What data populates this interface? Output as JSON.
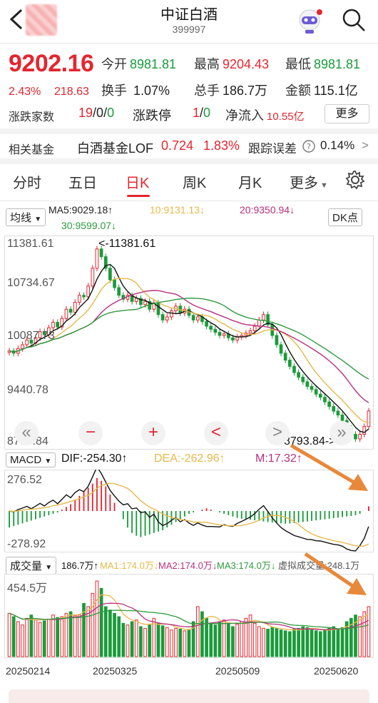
{
  "header": {
    "title": "中证白酒",
    "code": "399997"
  },
  "quote": {
    "price": "9202.16",
    "change_pct": "2.43%",
    "change_abs": "218.63",
    "open_label": "今开",
    "open": "8981.81",
    "high_label": "最高",
    "high": "9204.43",
    "low_label": "最低",
    "low": "8981.81",
    "turnover_label": "换手",
    "turnover": "1.07%",
    "volume_label": "总手",
    "volume": "186.7万",
    "amount_label": "金额",
    "amount": "115.1亿",
    "breadth_label": "涨跌家数",
    "breadth_up": "19",
    "breadth_sep1": "/",
    "breadth_flat": "0",
    "breadth_sep2": "/",
    "breadth_down": "0",
    "limit_label": "涨跌停",
    "limit_up": "1",
    "limit_sep": "/",
    "limit_down": "0",
    "netflow_label": "净流入",
    "netflow": "10.55亿",
    "more_button": "更多"
  },
  "fund": {
    "label": "相关基金",
    "name": "白酒基金LOF",
    "price": "0.724",
    "change": "1.83%",
    "tracking_label": "跟踪误差",
    "tracking_value": "0.14%",
    "chevron": ">"
  },
  "tabs": [
    "分时",
    "五日",
    "日K",
    "周K",
    "月K",
    "更多"
  ],
  "active_tab": "日K",
  "ma_legend": {
    "selector": "均线",
    "ma5": "MA5:9029.18↑",
    "ma10": "10:9131.13↓",
    "ma20": "20:9350.94↓",
    "ma30": "30:9599.07↓",
    "dk_button": "DK点"
  },
  "price_axis": {
    "top": "11381.61",
    "l2": "10734.67",
    "l3": "10087.73",
    "l4": "9440.78",
    "bottom": "8793.84",
    "max_note": "<-11381.61",
    "min_note": "8793.84->"
  },
  "macd_legend": {
    "selector": "MACD",
    "dif": "DIF:-254.30↑",
    "dea": "DEA:-262.96↑",
    "m": "M:17.32↑",
    "top": "276.52",
    "bottom": "-278.92"
  },
  "vol_legend": {
    "selector": "成交量",
    "vol": "186.7万↑",
    "ma1": "MA1:174.0万↓",
    "ma2": "MA2:174.0万↓",
    "ma3": "MA3:174.0万↓",
    "virtual": "虚拟成交量:248.1万",
    "top": "454.5万"
  },
  "dates": [
    "20250214",
    "20250325",
    "20250509",
    "20250620"
  ],
  "controls": [
    "«",
    "−",
    "+",
    "<",
    ">",
    "»"
  ],
  "colors": {
    "up": "#e3262f",
    "down": "#1a9b3a",
    "ma5": "#111111",
    "ma10": "#e8b84a",
    "ma20": "#b8307e",
    "ma30": "#2f9a3f",
    "arrow": "#e8883a"
  },
  "chart_data": {
    "type": "candlestick",
    "ylim": [
      8793.84,
      11381.61
    ],
    "closes": [
      9980,
      9950,
      10010,
      10060,
      10120,
      10080,
      10150,
      10230,
      10190,
      10280,
      10350,
      10290,
      10400,
      10520,
      10480,
      10610,
      10700,
      10680,
      10820,
      11050,
      11300,
      11200,
      11050,
      10900,
      10800,
      10700,
      10650,
      10700,
      10620,
      10660,
      10580,
      10620,
      10520,
      10600,
      10450,
      10380,
      10420,
      10500,
      10560,
      10470,
      10520,
      10440,
      10380,
      10420,
      10360,
      10300,
      10260,
      10220,
      10180,
      10200,
      10150,
      10120,
      10160,
      10180,
      10210,
      10240,
      10300,
      10380,
      10450,
      10320,
      10180,
      10060,
      9950,
      9860,
      9780,
      9700,
      9640,
      9580,
      9520,
      9480,
      9420,
      9380,
      9320,
      9260,
      9200,
      9150,
      9080,
      8980,
      8900,
      8840,
      8900,
      9000,
      9202
    ],
    "macd_hist": [
      -60,
      -55,
      -50,
      -45,
      -40,
      -35,
      -30,
      -25,
      -20,
      -15,
      -10,
      -5,
      5,
      15,
      25,
      40,
      55,
      70,
      85,
      100,
      120,
      110,
      90,
      60,
      30,
      0,
      -30,
      -60,
      -80,
      -90,
      -95,
      -90,
      -85,
      -80,
      -75,
      -70,
      -60,
      -50,
      -40,
      -30,
      -20,
      -10,
      -5,
      0,
      5,
      10,
      5,
      0,
      -5,
      -10,
      -15,
      -20,
      -25,
      -28,
      -30,
      -32,
      -34,
      -36,
      -38,
      -40,
      -42,
      -44,
      -45,
      -46,
      -45,
      -44,
      -42,
      -40,
      -38,
      -36,
      -34,
      -32,
      -30,
      -28,
      -26,
      -24,
      -22,
      -20,
      -18,
      -15,
      -10,
      0,
      17
    ],
    "volumes": [
      260,
      240,
      210,
      190,
      230,
      250,
      220,
      205,
      215,
      225,
      250,
      235,
      240,
      260,
      270,
      245,
      250,
      320,
      300,
      380,
      454,
      410,
      300,
      280,
      260,
      240,
      200,
      190,
      210,
      220,
      180,
      170,
      190,
      230,
      200,
      185,
      175,
      160,
      170,
      165,
      155,
      160,
      210,
      300,
      270,
      230,
      200,
      190,
      210,
      220,
      200,
      180,
      195,
      210,
      230,
      250,
      200,
      180,
      170,
      165,
      175,
      170,
      160,
      155,
      150,
      165,
      170,
      180,
      175,
      160,
      155,
      150,
      160,
      170,
      180,
      165,
      175,
      210,
      230,
      250,
      240,
      270,
      300
    ]
  }
}
